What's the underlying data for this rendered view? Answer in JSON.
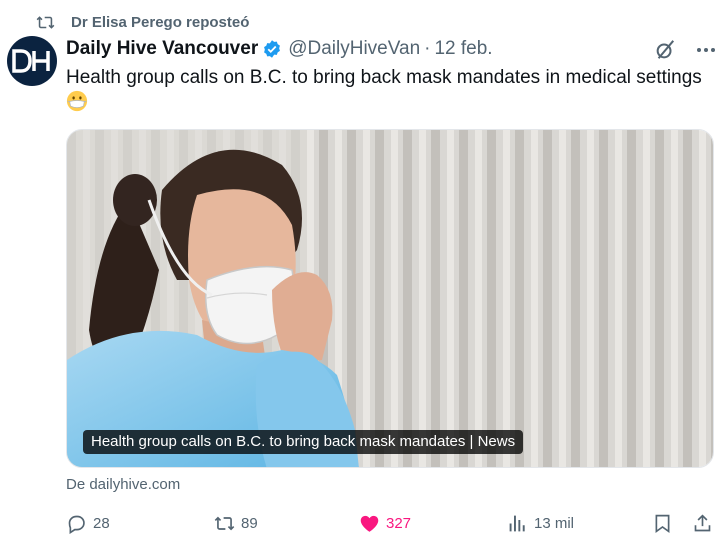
{
  "repost": {
    "icon": "repost-icon",
    "label": "Dr Elisa Perego reposteó"
  },
  "tweet": {
    "avatar_text": "DH",
    "author": "Daily Hive Vancouver",
    "verified_icon": "verified-badge-icon",
    "handle": "@DailyHiveVan",
    "separator": "·",
    "date": "12 feb.",
    "text": "Health group calls on B.C. to bring back mask mandates in medical settings",
    "emoji": "mask-face-emoji",
    "top_icons": [
      "grok-icon",
      "more-icon"
    ]
  },
  "card": {
    "caption": "Health group calls on B.C. to bring back mask mandates | News",
    "source": "De dailyhive.com"
  },
  "actions": {
    "reply_count": "28",
    "repost_count": "89",
    "like_count": "327",
    "views_count": "13 mil",
    "like_color": "#f91880",
    "icons": [
      "reply-icon",
      "repost-icon",
      "heart-icon",
      "views-icon",
      "bookmark-icon",
      "share-icon"
    ]
  },
  "colors": {
    "text": "#0f1419",
    "secondary": "#536471",
    "verified": "#1d9bf0",
    "avatar_bg": "#0b2340"
  }
}
